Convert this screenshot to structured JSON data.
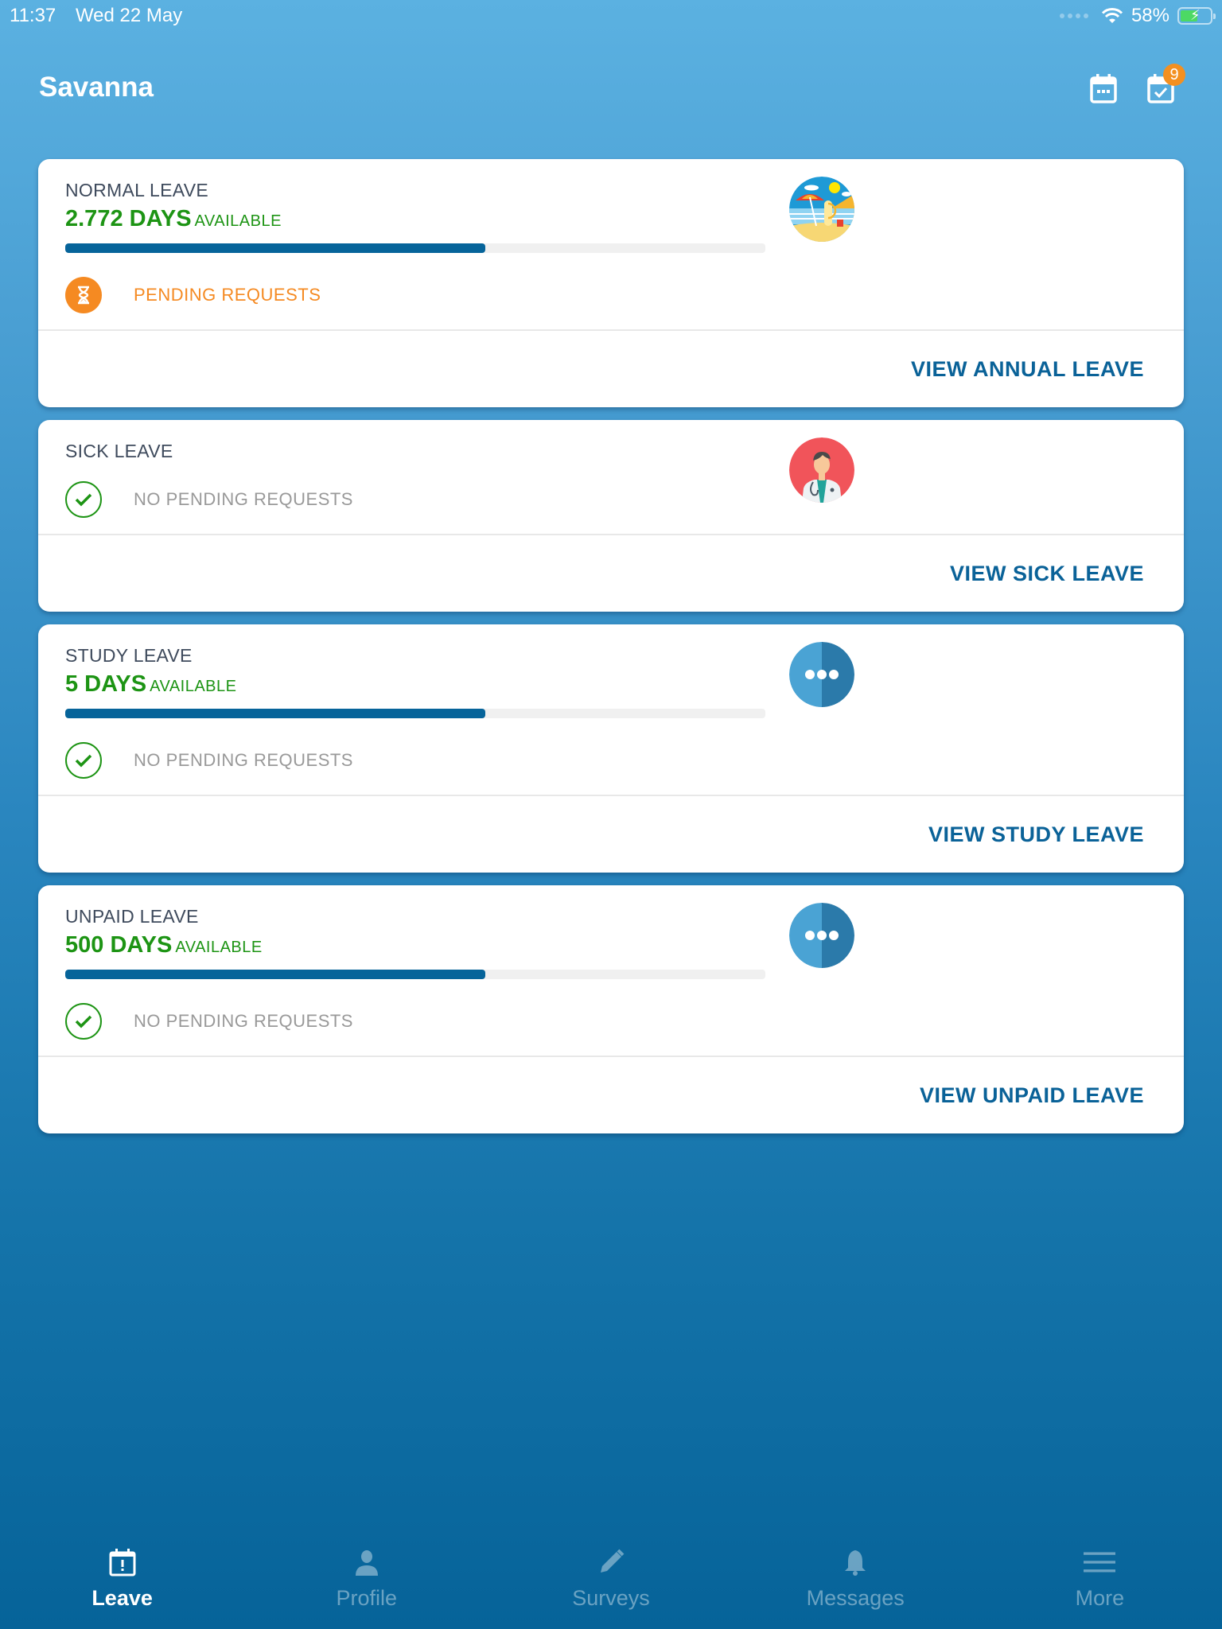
{
  "status_bar": {
    "time": "11:37",
    "date": "Wed 22 May",
    "battery_percent": "58%",
    "battery_level": 0.58,
    "charging": true
  },
  "header": {
    "title": "Savanna",
    "calendar_icon": "calendar-icon",
    "requests_icon": "calendar-check-icon",
    "requests_badge": "9"
  },
  "cards": [
    {
      "title": "NORMAL LEAVE",
      "days": "2.772 DAYS",
      "available_label": "AVAILABLE",
      "progress": 0.6,
      "request_status": "PENDING REQUESTS",
      "request_state": "pending",
      "image": "beach-illustration",
      "action": "VIEW ANNUAL LEAVE"
    },
    {
      "title": "SICK LEAVE",
      "request_status": "NO PENDING REQUESTS",
      "request_state": "ok",
      "image": "doctor-illustration",
      "action": "VIEW SICK LEAVE"
    },
    {
      "title": "STUDY LEAVE",
      "days": "5 DAYS",
      "available_label": "AVAILABLE",
      "progress": 0.6,
      "request_status": "NO PENDING REQUESTS",
      "request_state": "ok",
      "image": "more-dots-icon",
      "action": "VIEW STUDY LEAVE"
    },
    {
      "title": "UNPAID LEAVE",
      "days": "500 DAYS",
      "available_label": "AVAILABLE",
      "progress": 0.6,
      "request_status": "NO PENDING REQUESTS",
      "request_state": "ok",
      "image": "more-dots-icon",
      "action": "VIEW UNPAID LEAVE"
    }
  ],
  "tabs": [
    {
      "label": "Leave",
      "icon": "calendar-alert-icon",
      "active": true
    },
    {
      "label": "Profile",
      "icon": "person-icon",
      "active": false
    },
    {
      "label": "Surveys",
      "icon": "pencil-icon",
      "active": false
    },
    {
      "label": "Messages",
      "icon": "bell-icon",
      "active": false
    },
    {
      "label": "More",
      "icon": "menu-icon",
      "active": false
    }
  ],
  "colors": {
    "accent": "#06649a",
    "available_green": "#1d9414",
    "pending_orange": "#f58a22",
    "badge_orange": "#f39021"
  }
}
